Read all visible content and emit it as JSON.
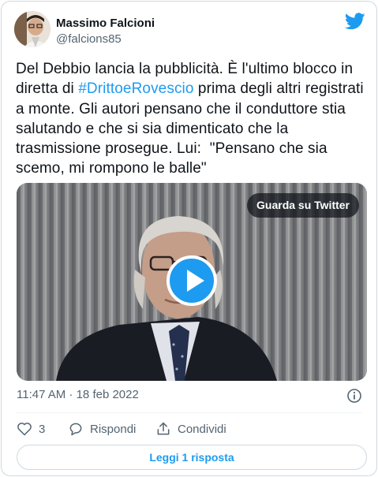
{
  "author": {
    "name": "Massimo Falcioni",
    "handle": "@falcions85"
  },
  "tweet": {
    "text_before": "Del Debbio lancia la pubblicità. È l'ultimo blocco in diretta di ",
    "hashtag": "#DrittoeRovescio",
    "text_after": " prima degli altri registrati a monte. Gli autori pensano che il conduttore stia salutando e che si sia dimenticato che la trasmissione prosegue. Lui:  \"Pensano che sia scemo, mi rompono le balle\""
  },
  "media": {
    "watch_label": "Guarda su Twitter"
  },
  "meta": {
    "timestamp": "11:47 AM · 18 feb 2022"
  },
  "actions": {
    "like_count": "3",
    "reply_label": "Rispondi",
    "share_label": "Condividi"
  },
  "footer": {
    "read_reply_label": "Leggi 1 risposta"
  },
  "colors": {
    "accent": "#1d9bf0",
    "secondary_text": "#536471",
    "border": "#cfd9de"
  },
  "icons": [
    "twitter-bird-icon",
    "play-icon",
    "info-icon",
    "heart-icon",
    "reply-icon",
    "share-icon"
  ]
}
